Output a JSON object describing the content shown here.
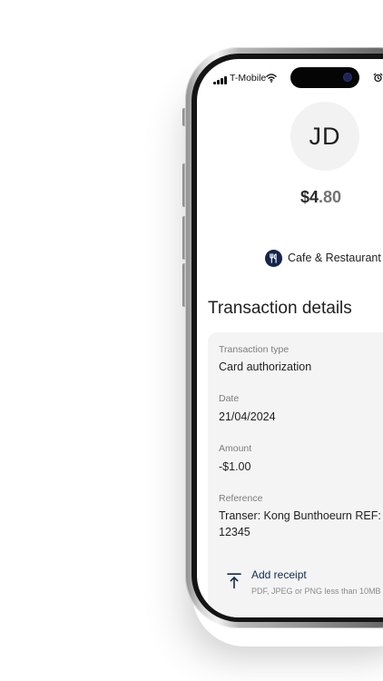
{
  "status_bar": {
    "carrier": "T-Mobile"
  },
  "avatar": {
    "initials": "JD"
  },
  "amount": {
    "whole": "$4",
    "cents": ".80"
  },
  "category": {
    "icon": "fork-knife-icon",
    "label": "Cafe & Restaurant"
  },
  "transaction": {
    "title": "Transaction details",
    "fields": [
      {
        "label": "Transaction type",
        "value": "Card authorization"
      },
      {
        "label": "Date",
        "value": "21/04/2024"
      },
      {
        "label": "Amount",
        "value": "-$1.00"
      },
      {
        "label": "Reference",
        "value_line1": "Transer: Kong Bunthoeurn REF:",
        "value_line2": "12345"
      }
    ]
  },
  "receipt": {
    "icon": "upload-icon",
    "title": "Add receipt",
    "hint": "PDF, JPEG or PNG less than 10MB"
  },
  "colors": {
    "brand_navy": "#14254a",
    "card_background": "#f4f4f4"
  }
}
